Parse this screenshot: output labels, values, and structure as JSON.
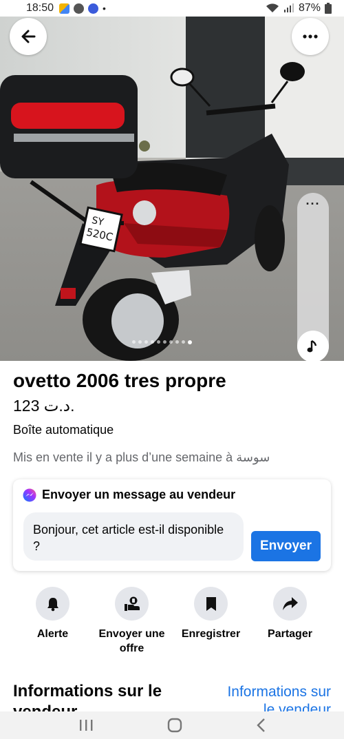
{
  "status_bar": {
    "time": "18:50",
    "battery": "87%"
  },
  "photo": {
    "plate_line1": "SY",
    "plate_line2": "520C",
    "carousel_count": 10,
    "carousel_active": 9
  },
  "listing": {
    "title": "ovetto 2006 tres propre",
    "price": "123 د.ت.",
    "condition": "Boîte automatique",
    "listed": "Mis en vente il y a plus d’une semaine à سوسة"
  },
  "message": {
    "header": "Envoyer un message au vendeur",
    "input_value": "Bonjour, cet article est-il disponible ?",
    "send_label": "Envoyer"
  },
  "actions": [
    {
      "label": "Alerte",
      "icon": "bell-icon"
    },
    {
      "label": "Envoyer une offre",
      "icon": "offer-icon"
    },
    {
      "label": "Enregistrer",
      "icon": "bookmark-icon"
    },
    {
      "label": "Partager",
      "icon": "share-icon"
    }
  ],
  "seller": {
    "title": "Informations sur le vendeur",
    "link": "Informations sur le vendeur"
  },
  "colors": {
    "accent": "#1b74e4",
    "secondary_text": "#65676b",
    "icon_bg": "#e4e6eb"
  }
}
